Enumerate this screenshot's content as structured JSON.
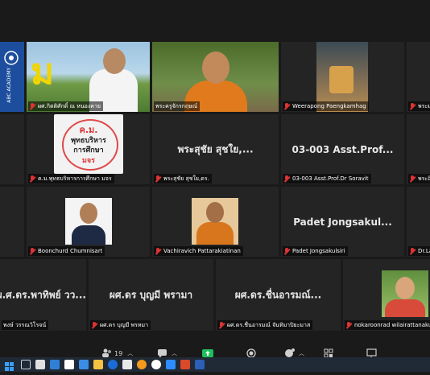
{
  "tiles": [
    {
      "id": "t1",
      "name": "",
      "mic_muted": false,
      "big_text": "",
      "has_video": true,
      "brand": "ABC ACADEMY"
    },
    {
      "id": "t2",
      "name": "ผศ.กิตติศักดิ์ ณ หนองคาย",
      "mic_muted": true,
      "big_text": "",
      "has_video": true
    },
    {
      "id": "t3",
      "name": "พระครูจักรกฤษณ์",
      "mic_muted": false,
      "big_text": "",
      "has_video": true,
      "active": true
    },
    {
      "id": "t4",
      "name": "Weerapong Paengkamhag",
      "mic_muted": true,
      "big_text": "",
      "has_video": true
    },
    {
      "id": "t5",
      "name": "พระมหา",
      "mic_muted": true,
      "big_text": "",
      "has_video": false
    },
    {
      "id": "t6",
      "name": "ค.ม.พุทธบริหารการศึกษา มจร",
      "mic_muted": true,
      "big_text": "",
      "has_video": true,
      "logo_lines": [
        "ค.ม.",
        "พุทธบริหาร",
        "การศึกษา",
        "มจร"
      ]
    },
    {
      "id": "t7",
      "name": "พระสุชัย สุชใย,ดร.",
      "mic_muted": true,
      "big_text": "พระสุชัย สุชใย,...",
      "has_video": false
    },
    {
      "id": "t8",
      "name": "03-003 Asst.Prof.Dr Soravit",
      "mic_muted": true,
      "big_text": "03-003 Asst.Prof...",
      "has_video": false
    },
    {
      "id": "t9",
      "name": "พระอิ",
      "mic_muted": true,
      "big_text": "",
      "has_video": false
    },
    {
      "id": "t10",
      "name": "Boonchurd Chumnisart",
      "mic_muted": true,
      "big_text": "",
      "has_video": true
    },
    {
      "id": "t11",
      "name": "Vachiravich Pattarakiatinan",
      "mic_muted": true,
      "big_text": "",
      "has_video": true
    },
    {
      "id": "t12",
      "name": "Padet Jongsakulsiri",
      "mic_muted": true,
      "big_text": "Padet Jongsakul...",
      "has_video": false
    },
    {
      "id": "t13",
      "name": "Dr.La",
      "mic_muted": true,
      "big_text": "",
      "has_video": false
    },
    {
      "id": "t14",
      "name": "พงษ์ วรรณวิโรจน์",
      "mic_muted": false,
      "big_text": "ผ.ศ.ดร.พาทิพย์ วว...",
      "has_video": false
    },
    {
      "id": "t15",
      "name": "ผศ.ดร บุญมี พรหมา",
      "mic_muted": true,
      "big_text": "ผศ.ดร บุญมี พรามา",
      "has_video": false
    },
    {
      "id": "t16",
      "name": "ผศ.ดร.ชื่นอารมณ์ จันทิมาปิยะมาส",
      "mic_muted": true,
      "big_text": "ผศ.ดร.ชื่นอารมณ์...",
      "has_video": false
    },
    {
      "id": "t17",
      "name": "nokaroonrad wilairattanakul",
      "mic_muted": true,
      "big_text": "",
      "has_video": true
    }
  ],
  "toolbar": {
    "participants_count": "19"
  },
  "colors": {
    "active_border": "#e6e15a",
    "mic_muted": "#dd3333",
    "tile_bg": "#242424",
    "share_green": "#1fbf5c"
  }
}
